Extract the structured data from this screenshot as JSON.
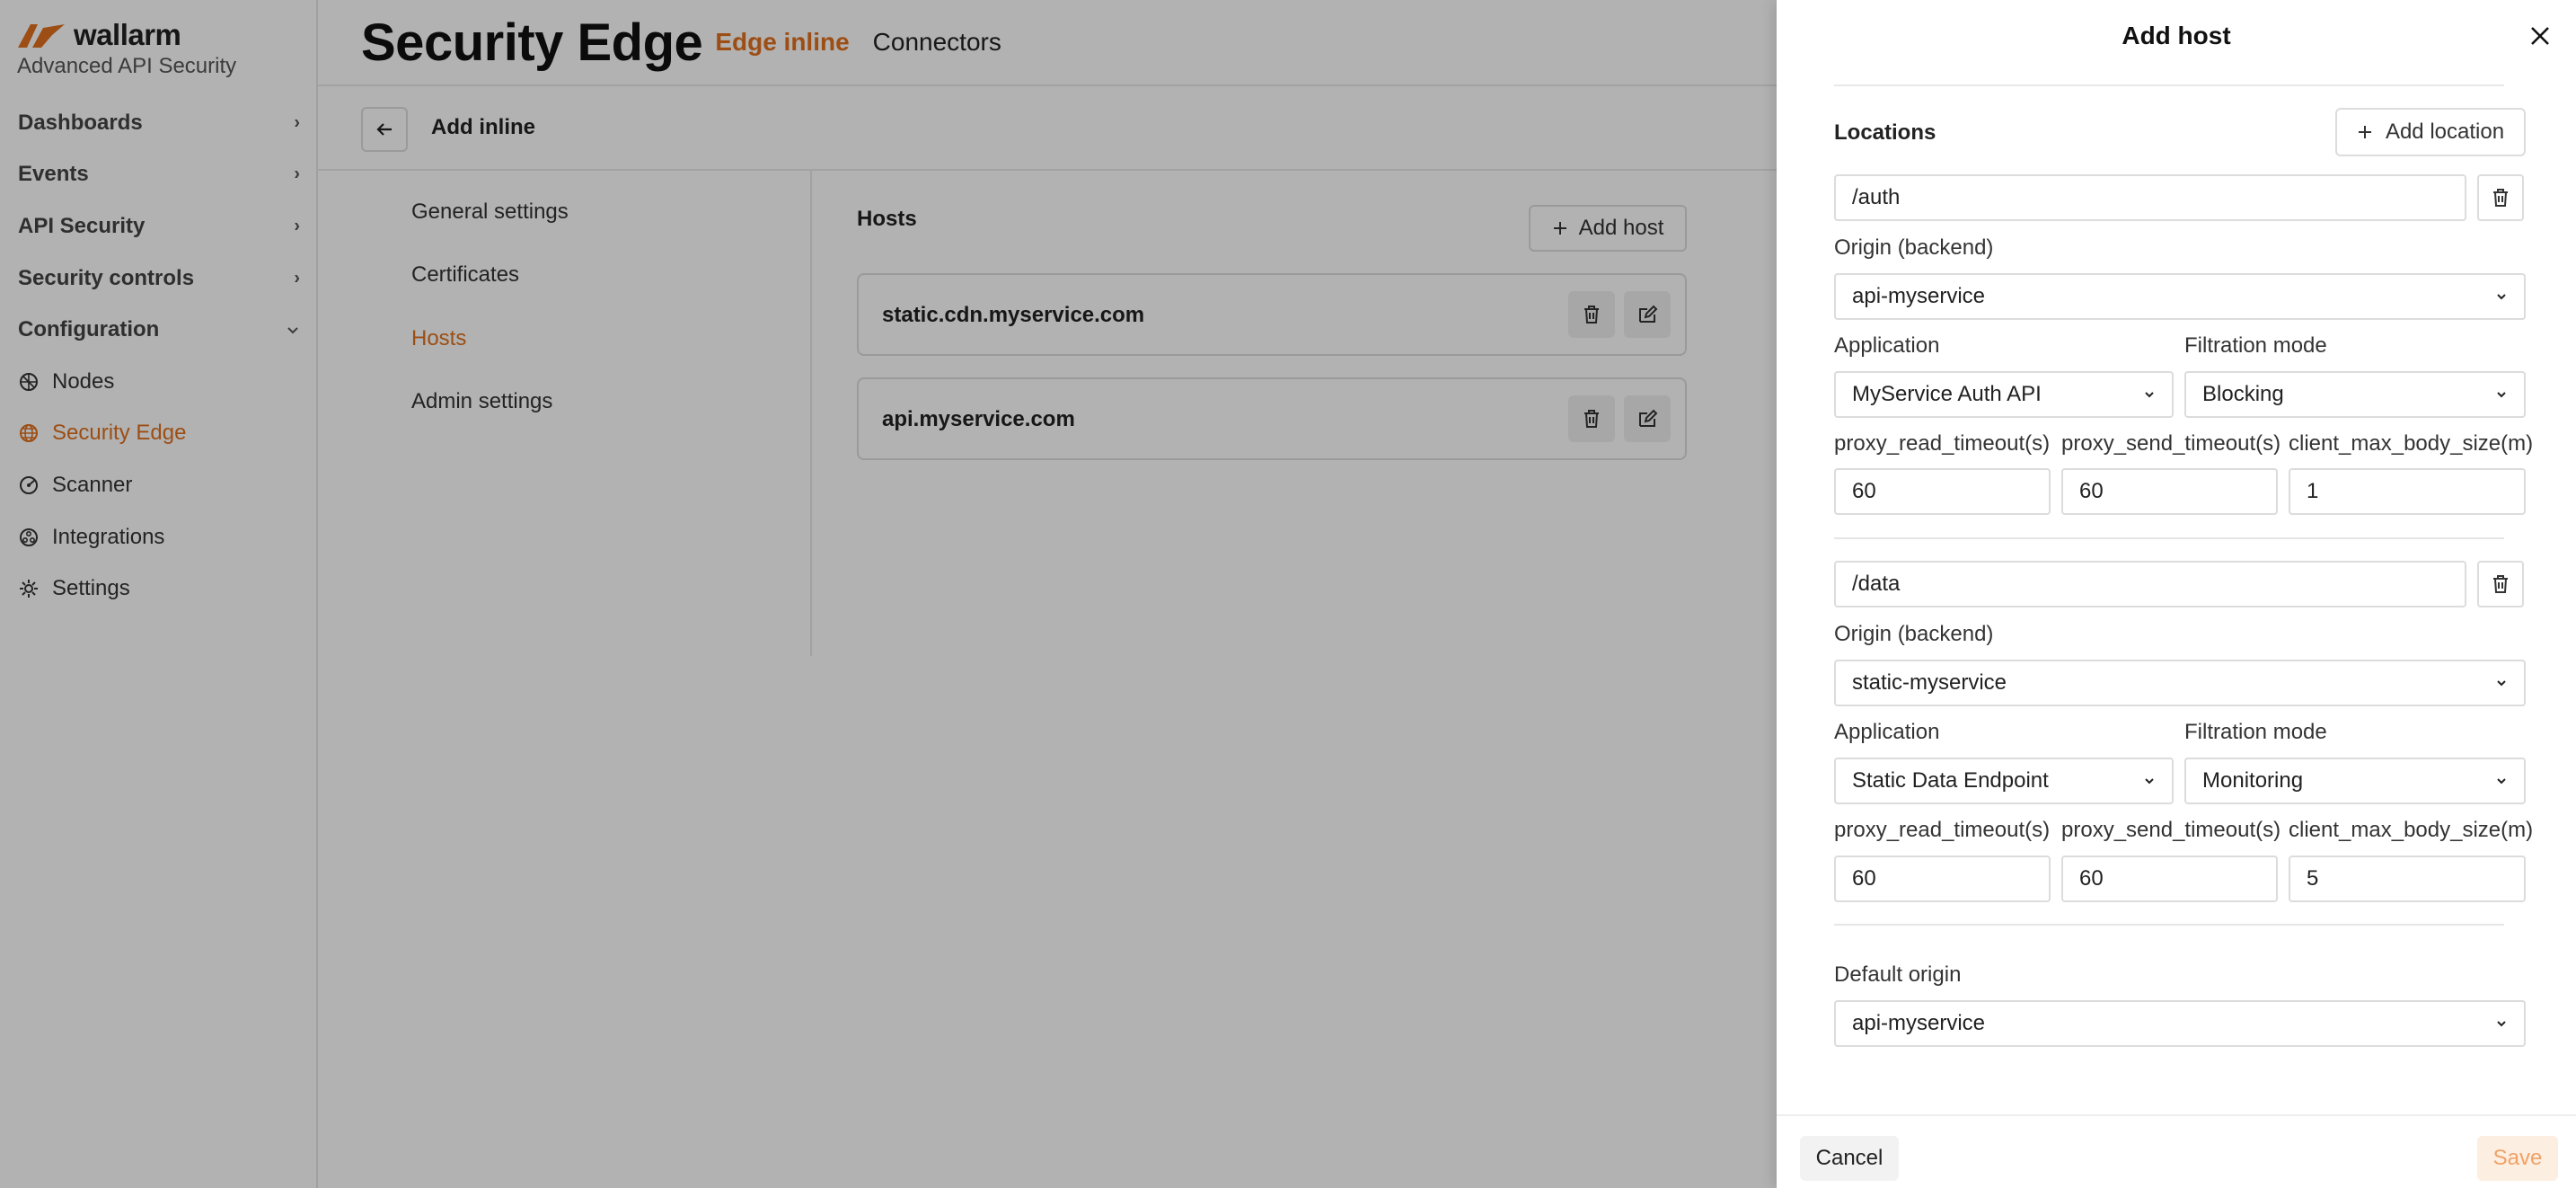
{
  "brand": {
    "name": "wallarm",
    "subtitle": "Advanced API Security",
    "accent": "#e0701e"
  },
  "sidebar": {
    "groups": [
      {
        "label": "Dashboards",
        "icon": "chevron-right-icon"
      },
      {
        "label": "Events",
        "icon": "chevron-right-icon"
      },
      {
        "label": "API Security",
        "icon": "chevron-right-icon"
      },
      {
        "label": "Security controls",
        "icon": "chevron-right-icon"
      },
      {
        "label": "Configuration",
        "icon": "chevron-down-icon"
      }
    ],
    "items": [
      {
        "label": "Nodes",
        "icon": "nodes-icon"
      },
      {
        "label": "Security Edge",
        "icon": "globe-icon",
        "active": true
      },
      {
        "label": "Scanner",
        "icon": "scanner-icon"
      },
      {
        "label": "Integrations",
        "icon": "integrations-icon"
      },
      {
        "label": "Settings",
        "icon": "gear-icon"
      }
    ]
  },
  "header": {
    "title": "Security Edge",
    "tabs": [
      {
        "label": "Edge inline",
        "active": true
      },
      {
        "label": "Connectors",
        "active": false
      }
    ]
  },
  "subbar": {
    "title": "Add inline"
  },
  "settings_nav": [
    {
      "label": "General settings"
    },
    {
      "label": "Certificates"
    },
    {
      "label": "Hosts",
      "active": true
    },
    {
      "label": "Admin settings"
    }
  ],
  "hosts": {
    "title": "Hosts",
    "add_label": "Add host",
    "list": [
      {
        "name": "static.cdn.myservice.com"
      },
      {
        "name": "api.myservice.com"
      }
    ]
  },
  "drawer": {
    "title": "Add host",
    "locations_label": "Locations",
    "add_location_label": "Add location",
    "origin_label": "Origin (backend)",
    "application_label": "Application",
    "filtration_label": "Filtration mode",
    "read_timeout_label": "proxy_read_timeout(s)",
    "send_timeout_label": "proxy_send_timeout(s)",
    "body_size_label": "client_max_body_size(m)",
    "locations": [
      {
        "path": "/auth",
        "origin": "api-myservice",
        "application": "MyService Auth API",
        "filtration": "Blocking",
        "read_timeout": "60",
        "send_timeout": "60",
        "body_size": "1"
      },
      {
        "path": "/data",
        "origin": "static-myservice",
        "application": "Static Data Endpoint",
        "filtration": "Monitoring",
        "read_timeout": "60",
        "send_timeout": "60",
        "body_size": "5"
      }
    ],
    "default_origin_label": "Default origin",
    "default_origin": "api-myservice",
    "cancel_label": "Cancel",
    "save_label": "Save"
  }
}
